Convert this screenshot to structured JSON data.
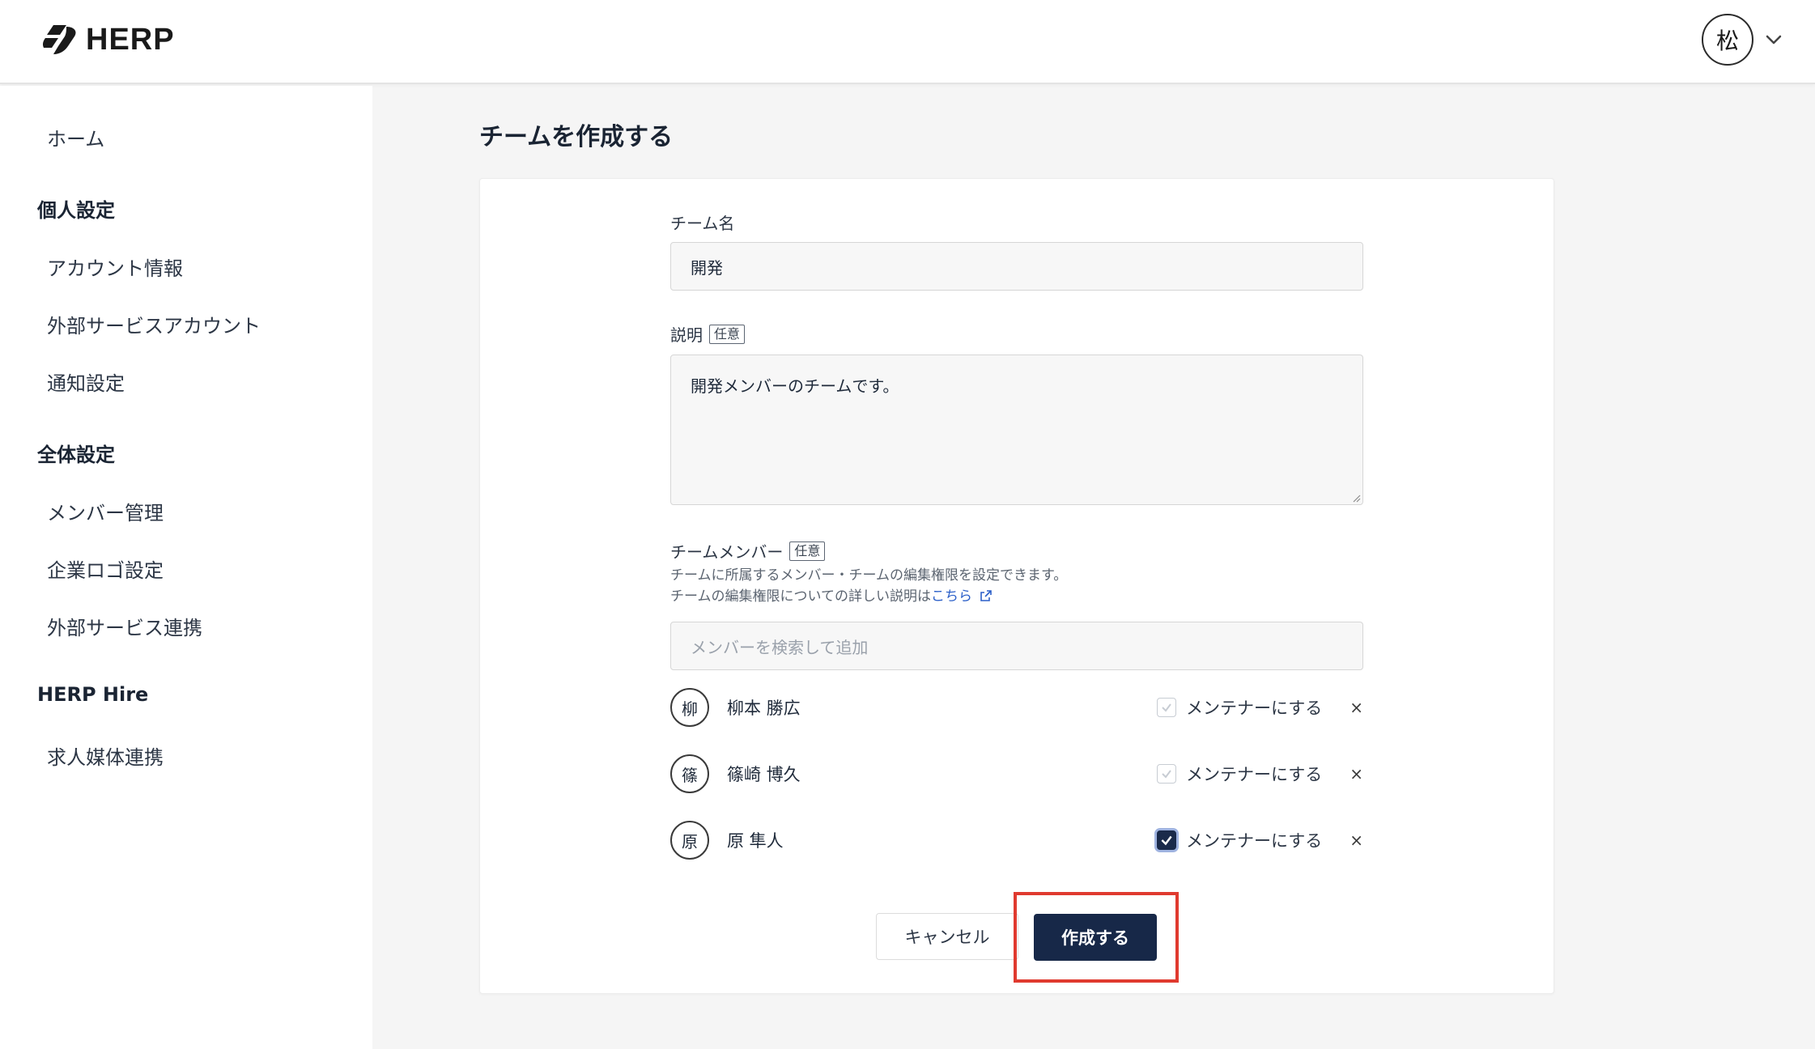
{
  "app": {
    "logo_text": "HERP"
  },
  "user": {
    "avatar_text": "松"
  },
  "sidebar": {
    "home": "ホーム",
    "sections": [
      {
        "title": "個人設定",
        "items": [
          "アカウント情報",
          "外部サービスアカウント",
          "通知設定"
        ]
      },
      {
        "title": "全体設定",
        "items": [
          "メンバー管理",
          "企業ロゴ設定",
          "外部サービス連携"
        ]
      },
      {
        "title": "HERP Hire",
        "items": [
          "求人媒体連携"
        ]
      }
    ]
  },
  "page": {
    "title": "チームを作成する"
  },
  "form": {
    "team_name_label": "チーム名",
    "team_name_value": "開発",
    "description_label": "説明",
    "optional_tag": "任意",
    "description_value": "開発メンバーのチームです。",
    "members_label": "チームメンバー",
    "members_help_1": "チームに所属するメンバー・チームの編集権限を設定できます。",
    "members_help_2": "チームの編集権限についての詳しい説明は",
    "members_help_link": "こちら",
    "member_search_placeholder": "メンバーを検索して追加",
    "maintainer_label": "メンテナーにする",
    "remove_symbol": "×",
    "members": [
      {
        "initial": "柳",
        "name": "柳本 勝広",
        "maintainer": false
      },
      {
        "initial": "篠",
        "name": "篠崎 博久",
        "maintainer": false
      },
      {
        "initial": "原",
        "name": "原 隼人",
        "maintainer": true
      }
    ],
    "cancel_label": "キャンセル",
    "submit_label": "作成する"
  },
  "colors": {
    "primary": "#172848",
    "highlight": "#e03a2f",
    "link": "#2b5fc8"
  }
}
